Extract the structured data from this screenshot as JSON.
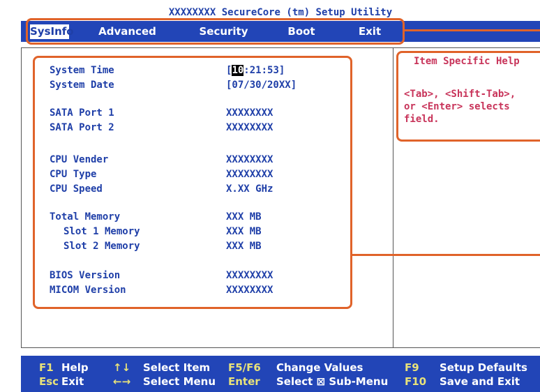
{
  "title": "XXXXXXXX SecureCore (tm) Setup Utility",
  "menu": [
    {
      "label": "SysInfo",
      "active": true
    },
    {
      "label": "Advanced",
      "active": false
    },
    {
      "label": "Security",
      "active": false
    },
    {
      "label": "Boot",
      "active": false
    },
    {
      "label": "Exit",
      "active": false
    }
  ],
  "sysinfo": {
    "system_time": {
      "label": "System Time",
      "open": "[",
      "cursor": "10",
      "rest": ":21:53]"
    },
    "system_date": {
      "label": "System Date",
      "value": "[07/30/20XX]"
    },
    "sata1": {
      "label": "SATA Port 1",
      "value": "XXXXXXXX"
    },
    "sata2": {
      "label": "SATA Port 2",
      "value": "XXXXXXXX"
    },
    "cpu_vender": {
      "label": "CPU Vender",
      "value": "XXXXXXXX"
    },
    "cpu_type": {
      "label": "CPU Type",
      "value": "XXXXXXXX"
    },
    "cpu_speed": {
      "label": "CPU Speed",
      "value": "X.XX GHz"
    },
    "total_memory": {
      "label": "Total Memory",
      "value": "XXX MB"
    },
    "slot1": {
      "label": "Slot 1 Memory",
      "value": "XXX MB"
    },
    "slot2": {
      "label": "Slot 2 Memory",
      "value": "XXX MB"
    },
    "bios": {
      "label": "BIOS Version",
      "value": "XXXXXXXX"
    },
    "micom": {
      "label": "MICOM Version",
      "value": "XXXXXXXX"
    }
  },
  "help": {
    "title": "Item Specific Help",
    "text": "<Tab>, <Shift-Tab>,\nor <Enter> selects\nfield."
  },
  "footer": {
    "f1_key": "F1",
    "f1_desc": "Help",
    "esc_key": "Esc",
    "esc_desc": "Exit",
    "updown_key": "↑↓",
    "updown_desc": "Select Item",
    "leftright_key": "←→",
    "leftright_desc": "Select Menu",
    "f5f6_key": "F5/F6",
    "f5f6_desc": "Change Values",
    "enter_key": "Enter",
    "enter_desc": "Select ⊠ Sub-Menu",
    "f9_key": "F9",
    "f9_desc": "Setup Defaults",
    "f10_key": "F10",
    "f10_desc": "Save and Exit"
  },
  "colors": {
    "bios_blue": "#2245b7",
    "help_text": "#c8345a",
    "callout": "#e0632a",
    "key_yellow": "#e8e27a"
  }
}
